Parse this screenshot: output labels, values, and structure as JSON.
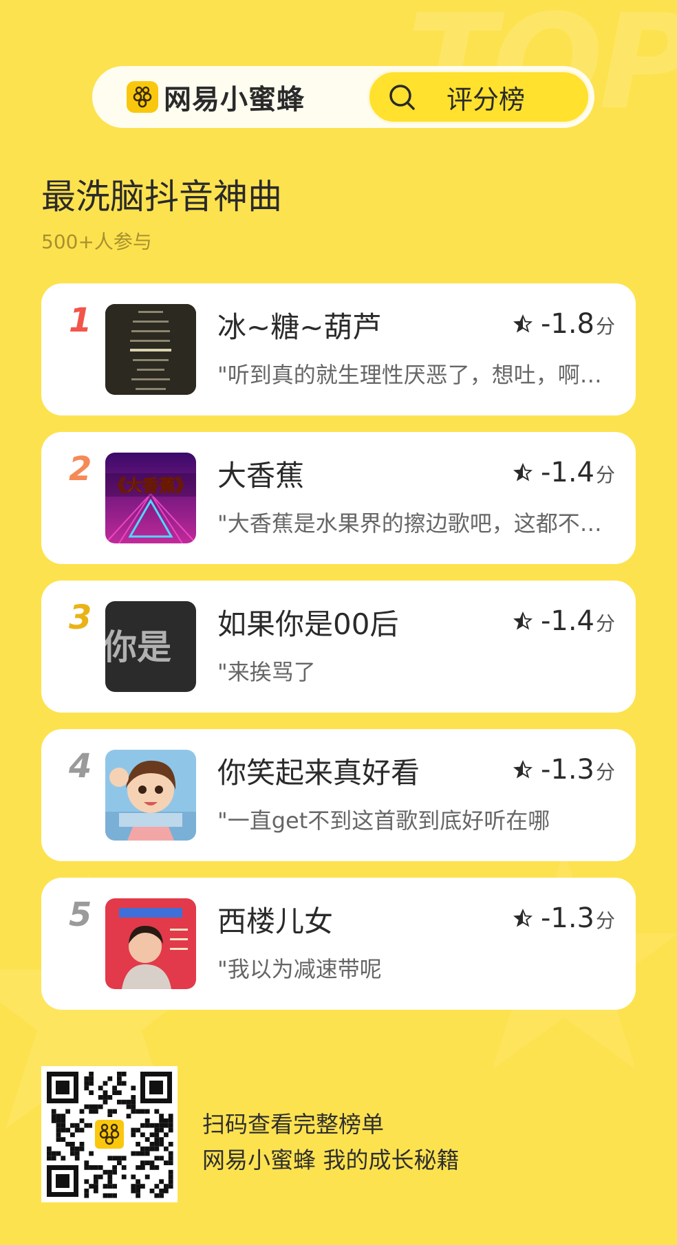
{
  "background": {
    "watermark": "TOP",
    "color": "#FDE24F"
  },
  "header": {
    "brand_name": "网易小蜜蜂",
    "brand_icon": "bee-icon",
    "rank_tab_label": "评分榜",
    "search_icon": "search-icon"
  },
  "list": {
    "title": "最洗脑抖音神曲",
    "participants": "500+人参与"
  },
  "items": [
    {
      "rank": "1",
      "rank_color": "#F2554A",
      "title": "冰~糖~葫芦",
      "score": "-1.8",
      "score_unit": "分",
      "quote": "\"听到真的就生理性厌恶了，想吐，啊…"
    },
    {
      "rank": "2",
      "rank_color": "#F58A57",
      "title": "大香蕉",
      "score": "-1.4",
      "score_unit": "分",
      "quote": "\"大香蕉是水果界的擦边歌吧，这都不…",
      "thumb_text": "《大香蕉》"
    },
    {
      "rank": "3",
      "rank_color": "#E9B318",
      "title": "如果你是00后",
      "score": "-1.4",
      "score_unit": "分",
      "quote": "\"来挨骂了",
      "thumb_text": "你是"
    },
    {
      "rank": "4",
      "rank_color": "#9A9A9A",
      "title": "你笑起来真好看",
      "score": "-1.3",
      "score_unit": "分",
      "quote": "\"一直get不到这首歌到底好听在哪"
    },
    {
      "rank": "5",
      "rank_color": "#9A9A9A",
      "title": "西楼儿女",
      "score": "-1.3",
      "score_unit": "分",
      "quote": "\"我以为减速带呢"
    }
  ],
  "footer": {
    "line1": "扫码查看完整榜单",
    "line2": "网易小蜜蜂 我的成长秘籍",
    "qr_icon": "qr-code"
  }
}
